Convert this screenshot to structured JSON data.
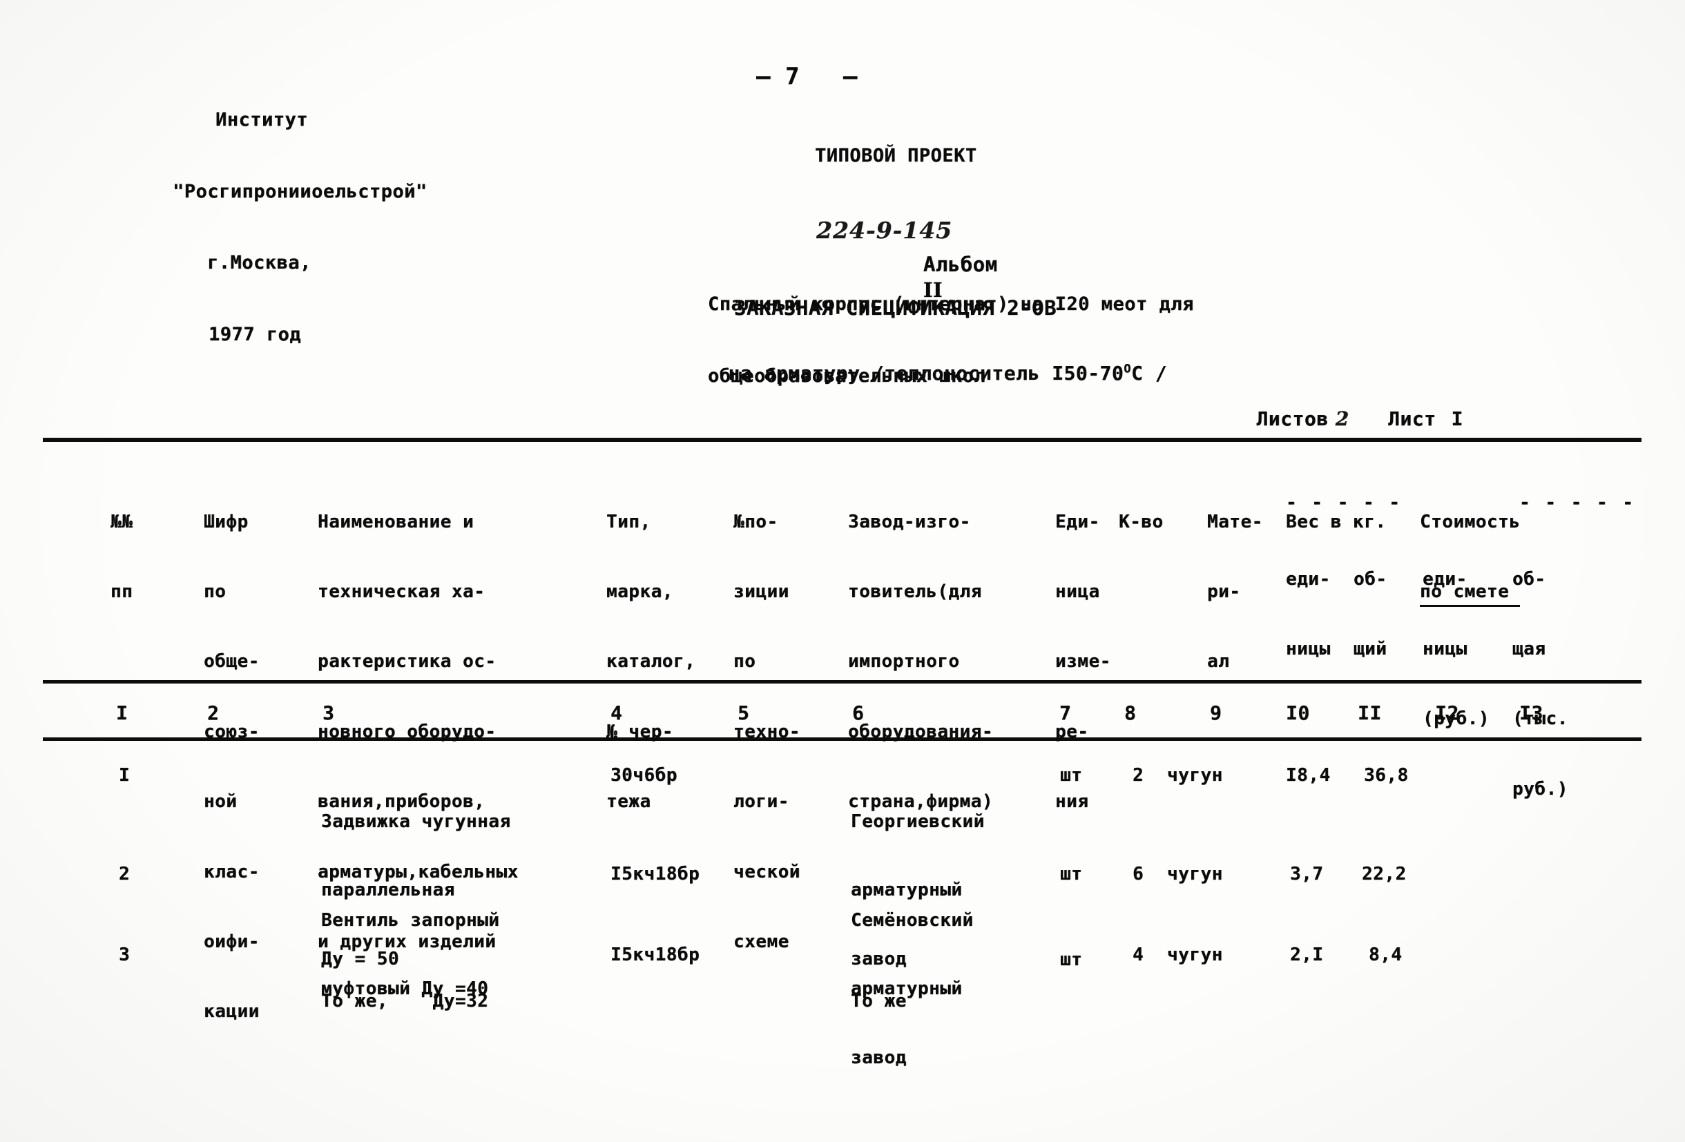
{
  "document": {
    "page_number": "– 7   –",
    "institute": {
      "line1": "Институт",
      "line2": "\"Росгипронииоельстрой\"",
      "line3": "г.Москва,",
      "line4": "1977 год"
    },
    "project": {
      "type_label": "ТИПОВОЙ ПРОЕКТ",
      "number": "224-9-145",
      "object_line1": "Спальный корпус (интернат) на I20 меот для",
      "object_line2": "общеобразовательных школ"
    },
    "album": {
      "label": "Альбом",
      "number": "II"
    },
    "spec": {
      "title": "ЗАКАЗНАЯ СПЕЦИФИКАЦИЯ 2-ОВ",
      "subtitle_before": "на арматуру /теплоноситель I50-70",
      "subtitle_sup": "O",
      "subtitle_after": "С /"
    },
    "sheets": {
      "total_label": "Листов",
      "total_value": "2",
      "sheet_label": "Лист",
      "sheet_value": "I"
    }
  },
  "table": {
    "headers": [
      {
        "id": "col-1",
        "lines": [
          "№№",
          "пп"
        ]
      },
      {
        "id": "col-2",
        "lines": [
          "Шифр",
          "по",
          "обще-",
          "союз-",
          "ной",
          "клас-",
          "оифи-",
          "кации"
        ]
      },
      {
        "id": "col-3",
        "lines": [
          "Наименование и",
          "техническая ха-",
          "рактеристика ос-",
          "новного оборудо-",
          "вания,приборов,",
          "арматуры,кабельных",
          "и других изделий"
        ]
      },
      {
        "id": "col-4",
        "lines": [
          "Тип,",
          "марка,",
          "каталог,",
          "№ чер-",
          "тежа"
        ]
      },
      {
        "id": "col-5",
        "lines": [
          "№по-",
          "зиции",
          "по",
          "техно-",
          "логи-",
          "ческой",
          "схеме"
        ]
      },
      {
        "id": "col-6",
        "lines": [
          "Завод-изго-",
          "товитель(для",
          "импортного",
          "оборудования-",
          "страна,фирма)"
        ]
      },
      {
        "id": "col-7",
        "lines": [
          "Еди-",
          "ница",
          "изме-",
          "ре-",
          "ния"
        ]
      },
      {
        "id": "col-8",
        "lines": [
          "К-во"
        ]
      },
      {
        "id": "col-9",
        "lines": [
          "Мате-",
          "ри-",
          "ал"
        ]
      },
      {
        "id": "col-10-11-group",
        "lines": [
          "Вес в кг."
        ]
      },
      {
        "id": "col-10",
        "lines": [
          "еди-",
          "ницы"
        ]
      },
      {
        "id": "col-11",
        "lines": [
          "об-",
          "щий"
        ]
      },
      {
        "id": "col-12-13-group",
        "lines": [
          "Стоимость",
          "по смете"
        ]
      },
      {
        "id": "col-12",
        "lines": [
          "еди-",
          "ницы",
          "(руб.)"
        ]
      },
      {
        "id": "col-13",
        "lines": [
          "об-",
          "щая",
          "(тыс.",
          "руб.)"
        ]
      }
    ],
    "column_numbers": [
      "I",
      "2",
      "3",
      "4",
      "5",
      "6",
      "7",
      "8",
      "9",
      "I0",
      "II",
      "I2",
      "I3"
    ],
    "dash_rule_weight": "- - - - -",
    "rows": [
      {
        "num": "I",
        "code": "",
        "name_lines": [
          "Задвижка чугунная",
          "параллельная",
          "Ду = 50"
        ],
        "type": "30ч6бр",
        "position": "",
        "manufacturer_lines": [
          "Георгиевский",
          "арматурный",
          "завод"
        ],
        "unit": "шт",
        "qty": "2",
        "material": "чугун",
        "weight_unit": "I8,4",
        "weight_total": "36,8",
        "cost_unit": "",
        "cost_total": ""
      },
      {
        "num": "2",
        "code": "",
        "name_lines": [
          "Вентиль запорный",
          "муфтовый Ду =40"
        ],
        "type": "I5кч18бр",
        "position": "",
        "manufacturer_lines": [
          "Семёновский",
          "арматурный",
          "завод"
        ],
        "unit": "шт",
        "qty": "6",
        "material": "чугун",
        "weight_unit": "3,7",
        "weight_total": "22,2",
        "cost_unit": "",
        "cost_total": ""
      },
      {
        "num": "3",
        "code": "",
        "name_lines": [
          "То же,    Ду=32"
        ],
        "type": "I5кч18бр",
        "position": "",
        "manufacturer_lines": [
          "То же"
        ],
        "unit": "шт",
        "qty": "4",
        "material": "чугун",
        "weight_unit": "2,I",
        "weight_total": "8,4",
        "cost_unit": "",
        "cost_total": ""
      }
    ]
  }
}
